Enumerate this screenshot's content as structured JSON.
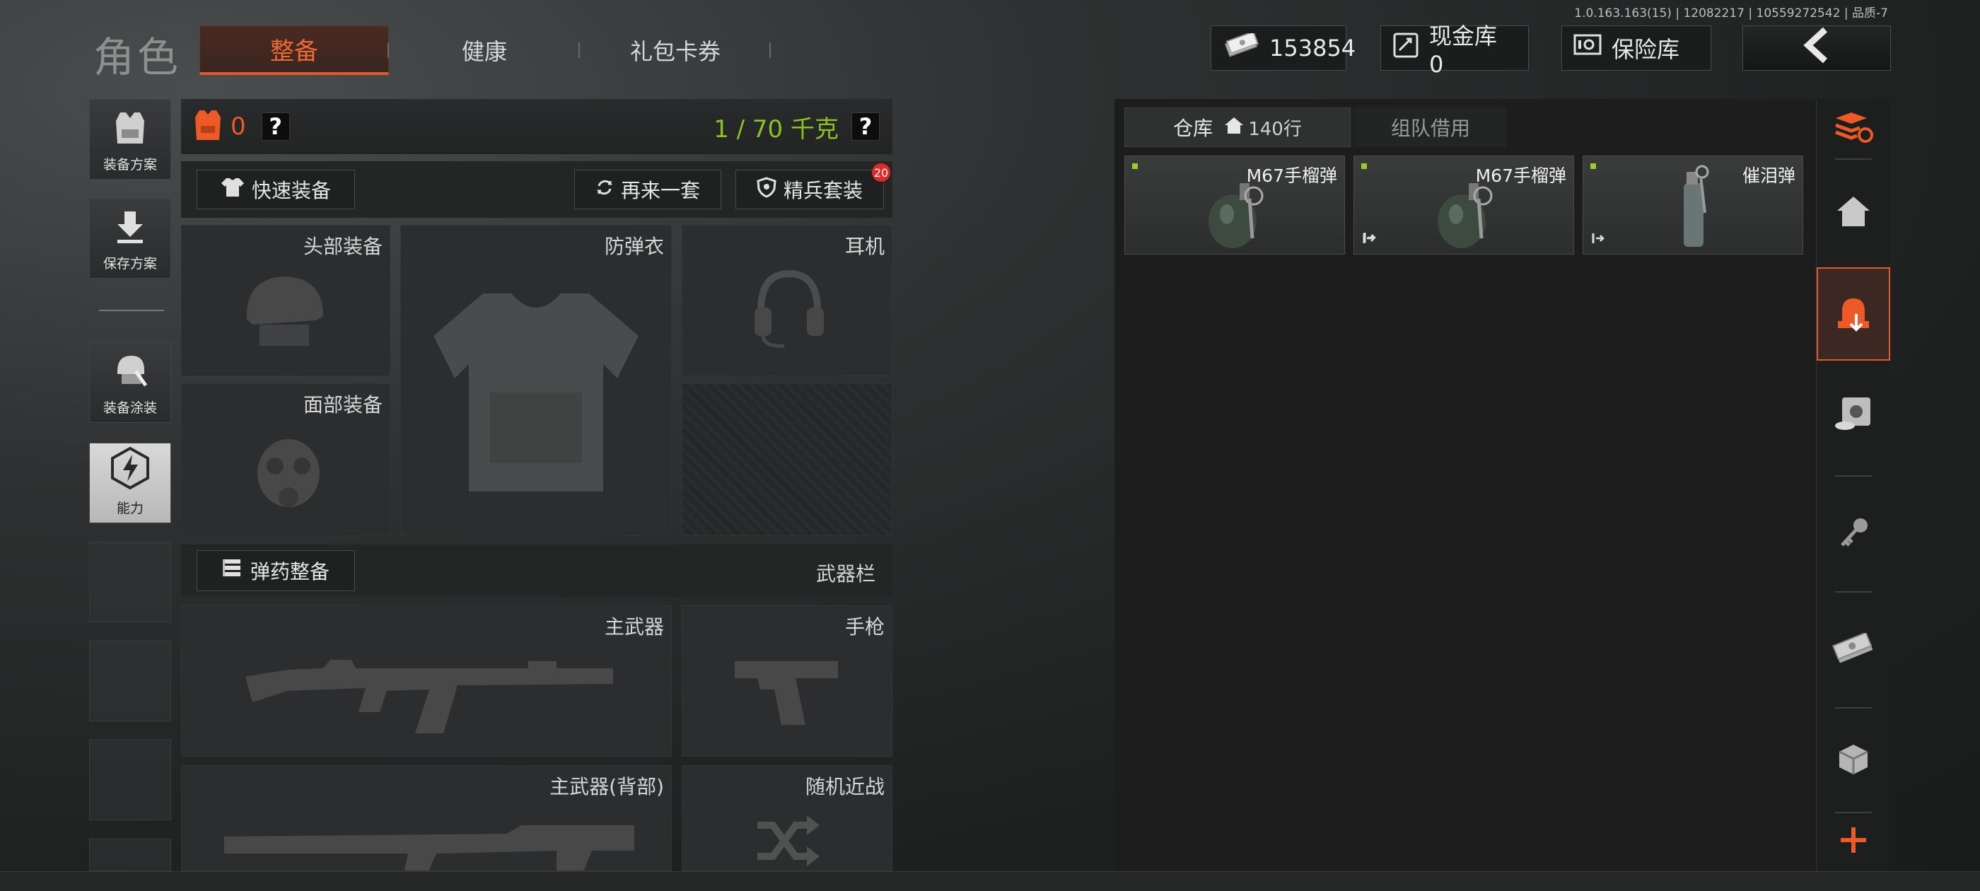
{
  "version": "1.0.163.163(15) | 12082217 | 10559272542 | 品质-7",
  "header": {
    "title": "角色",
    "tabs": [
      {
        "label": "整备"
      },
      {
        "label": "健康"
      },
      {
        "label": "礼包卡券"
      }
    ],
    "money": "153854",
    "cashbox_label": "现金库 0",
    "safebox_label": "保险库"
  },
  "left_sidebar": {
    "items": [
      {
        "label": "装备方案"
      },
      {
        "label": "保存方案"
      },
      {
        "label": "装备涂装"
      },
      {
        "label": "能力"
      }
    ]
  },
  "loadout": {
    "armor_count": "0",
    "help": "?",
    "weight": "1 / 70 千克",
    "quick_equip": "快速装备",
    "again": "再来一套",
    "elite": "精兵套装",
    "elite_badge": "20",
    "slots": {
      "head": "头部装备",
      "vest": "防弹衣",
      "ear": "耳机",
      "face": "面部装备",
      "primary": "主武器",
      "pistol": "手枪",
      "primary_back": "主武器(背部)",
      "melee": "随机近战"
    },
    "ammo": "弹药整备",
    "weapon_bar": "武器栏"
  },
  "warehouse": {
    "tab1": "仓库",
    "tab1_rows": "140行",
    "tab2": "组队借用",
    "items": [
      {
        "name": "M67手榴弹",
        "icon": "grenade-icon"
      },
      {
        "name": "M67手榴弹",
        "icon": "grenade-icon"
      },
      {
        "name": "催泪弹",
        "icon": "tear-gas-icon"
      }
    ]
  },
  "colors": {
    "accent": "#e4582b",
    "weight": "#89c322"
  }
}
